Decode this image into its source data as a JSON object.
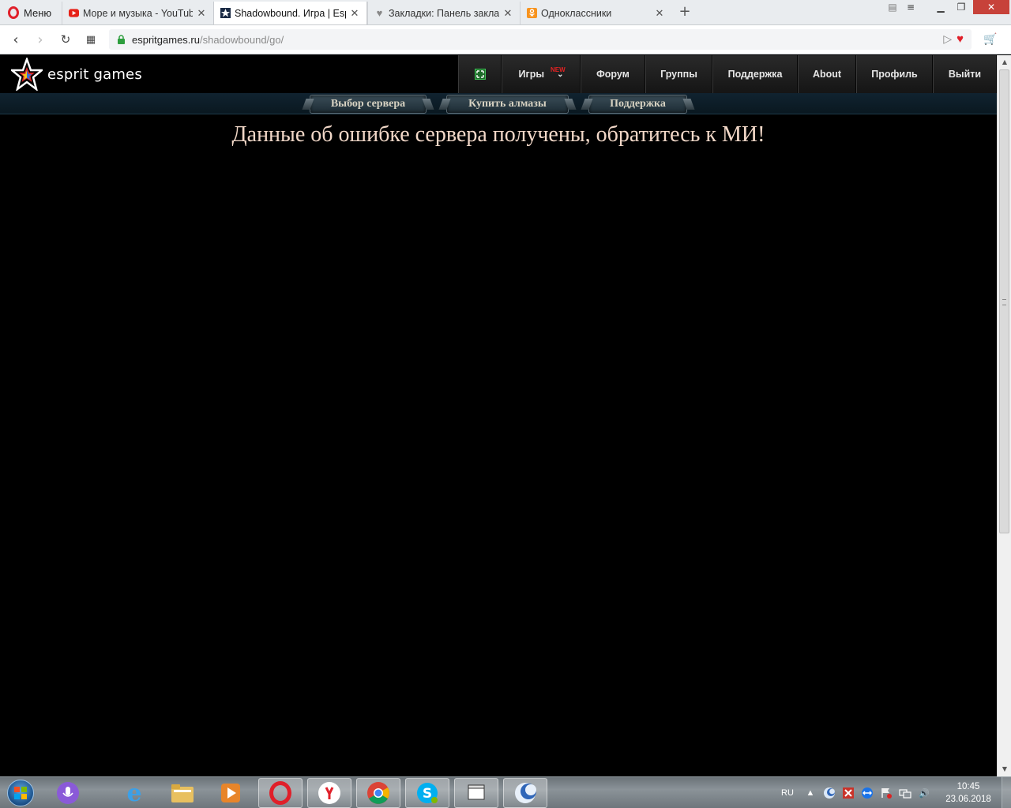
{
  "browser": {
    "menu_label": "Меню",
    "tabs": [
      {
        "title": "Море и музыка - YouTube",
        "icon": "youtube-icon"
      },
      {
        "title": "Shadowbound. Игра | Esprit",
        "icon": "espritgames-icon"
      },
      {
        "title": "Закладки: Панель закладок",
        "icon": "heart-icon"
      },
      {
        "title": "Одноклассники",
        "icon": "odnoklassniki-icon"
      }
    ],
    "address": {
      "host": "espritgames.ru",
      "path": "/shadowbound/go/"
    }
  },
  "site": {
    "logo_text": "esprit games",
    "nav": [
      {
        "label": ""
      },
      {
        "label": "Игры",
        "badge": "NEW"
      },
      {
        "label": "Форум"
      },
      {
        "label": "Группы"
      },
      {
        "label": "Поддержка"
      },
      {
        "label": "About"
      },
      {
        "label": "Профиль"
      },
      {
        "label": "Выйти"
      }
    ],
    "subnav": [
      {
        "label": "Выбор сервера"
      },
      {
        "label": "Купить алмазы"
      },
      {
        "label": "Поддержка"
      }
    ],
    "error_message": "Данные об ошибке сервера получены, обратитесь к МИ!"
  },
  "taskbar": {
    "language": "RU",
    "time": "10:45",
    "date": "23.06.2018"
  },
  "colors": {
    "page_bg": "#000000",
    "error_text": "#f2d8c8",
    "opera_red": "#e0202a",
    "new_badge": "#e02222"
  }
}
